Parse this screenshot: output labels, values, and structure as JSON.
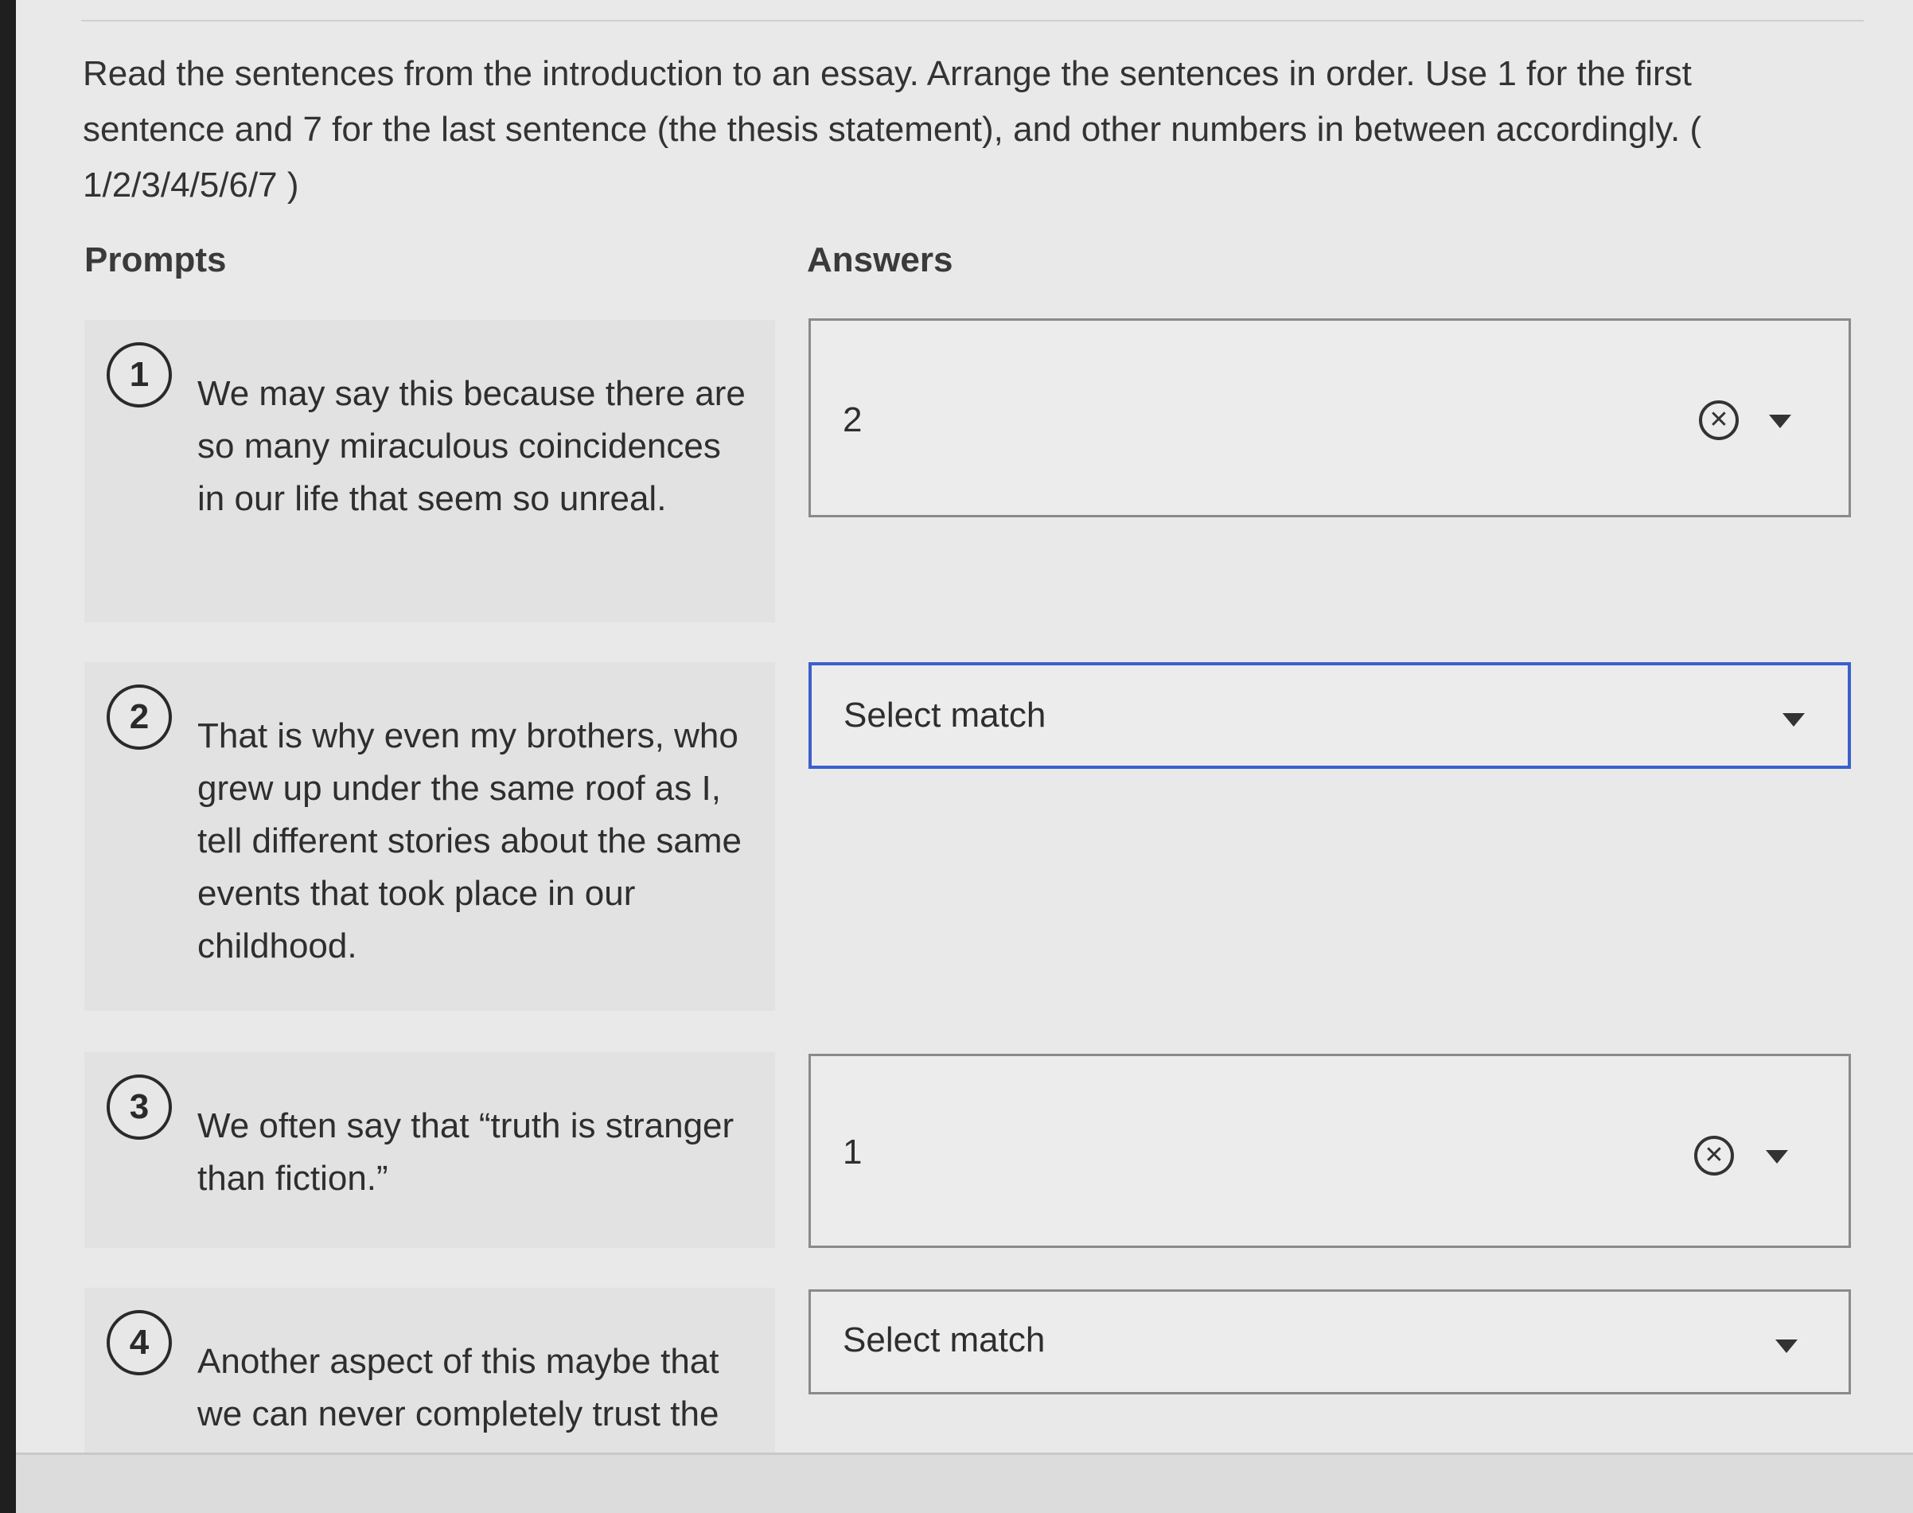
{
  "instructions": "Read the sentences from the introduction to an essay. Arrange the sentences in order. Use 1 for the first sentence and 7 for the last sentence (the thesis statement), and other numbers in between accordingly. ( 1/2/3/4/5/6/7 )",
  "columns": {
    "prompts": "Prompts",
    "answers": "Answers"
  },
  "prompts": [
    {
      "number": "1",
      "text": "We may say this because there are so many miraculous coincidences in our life that seem so unreal."
    },
    {
      "number": "2",
      "text": "That is why even my brothers, who grew up under the same roof as I, tell different stories about the same events that took place in our childhood."
    },
    {
      "number": "3",
      "text": "We often say that “truth is stranger than fiction.”"
    },
    {
      "number": "4",
      "text": "Another aspect of this maybe that we can never completely trust the"
    }
  ],
  "answers": [
    {
      "value": "2",
      "selected": true,
      "clear_icon": "clear-circle-x-icon",
      "dropdown_icon": "chevron-down-icon"
    },
    {
      "value": "Select match",
      "selected": false,
      "dropdown_icon": "chevron-down-icon"
    },
    {
      "value": "1",
      "selected": true,
      "clear_icon": "clear-circle-x-icon",
      "dropdown_icon": "chevron-down-icon"
    },
    {
      "value": "Select match",
      "selected": false,
      "dropdown_icon": "chevron-down-icon"
    }
  ],
  "icons": {
    "clear_glyph": "✕"
  },
  "colors": {
    "focus_border": "#3b5fcf",
    "background": "#e9e9ea"
  }
}
